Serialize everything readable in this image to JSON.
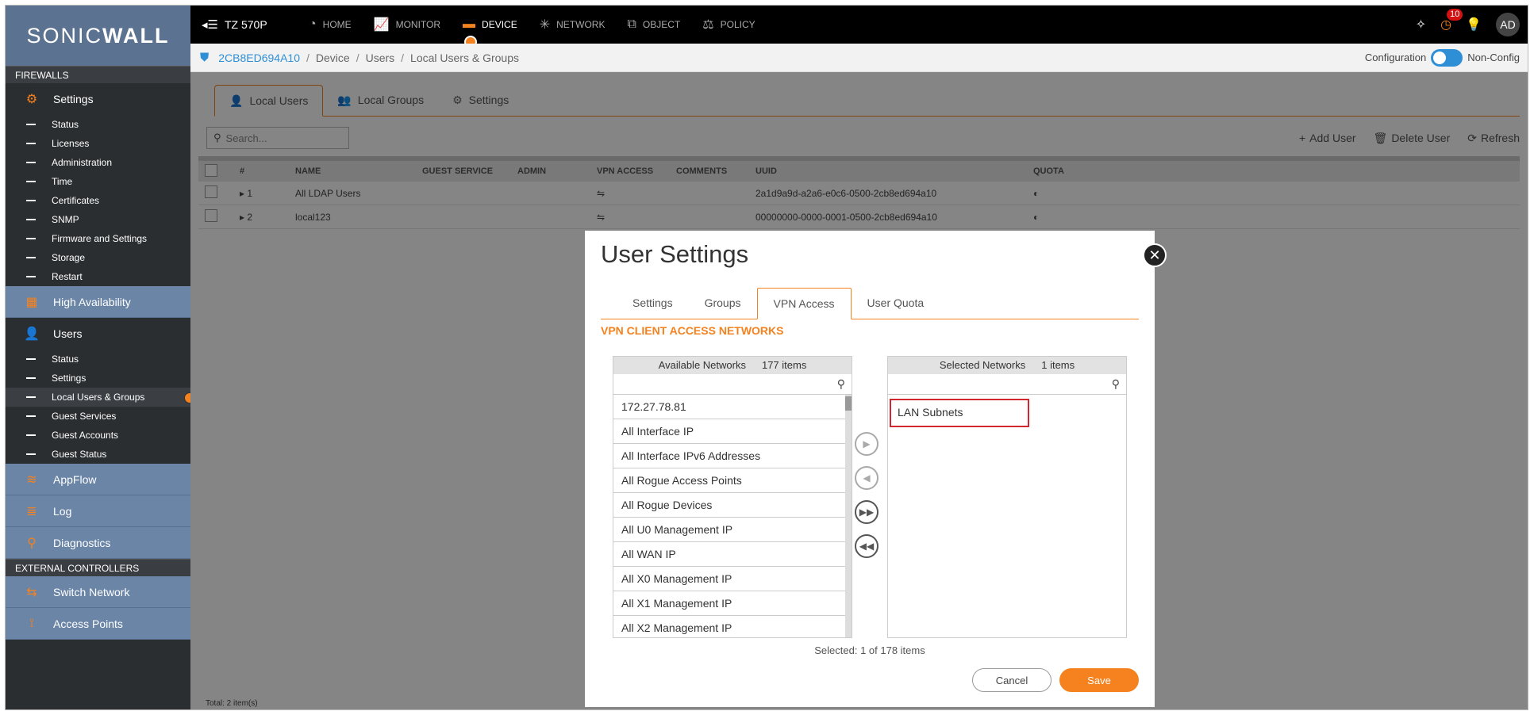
{
  "sidebar": {
    "logo_prefix": "SONIC",
    "logo_suffix": "WALL",
    "section_firewalls": "FIREWALLS",
    "settings": {
      "label": "Settings",
      "items": [
        "Status",
        "Licenses",
        "Administration",
        "Time",
        "Certificates",
        "SNMP",
        "Firmware and Settings",
        "Storage",
        "Restart"
      ]
    },
    "high_availability": "High Availability",
    "users": {
      "label": "Users",
      "items": [
        "Status",
        "Settings",
        "Local Users & Groups",
        "Guest Services",
        "Guest Accounts",
        "Guest Status"
      ]
    },
    "appflow": "AppFlow",
    "log": "Log",
    "diagnostics": "Diagnostics",
    "section_external": "EXTERNAL CONTROLLERS",
    "switch_network": "Switch Network",
    "access_points": "Access Points"
  },
  "topbar": {
    "device": "TZ 570P",
    "nav": [
      "HOME",
      "MONITOR",
      "DEVICE",
      "NETWORK",
      "OBJECT",
      "POLICY"
    ],
    "notification_count": "10",
    "avatar": "AD"
  },
  "breadcrumb": {
    "items": [
      "2CB8ED694A10",
      "Device",
      "Users",
      "Local Users & Groups"
    ],
    "configuration": "Configuration",
    "non_config": "Non-Config"
  },
  "main": {
    "tabs": [
      "Local Users",
      "Local Groups",
      "Settings"
    ],
    "search_placeholder": "Search...",
    "actions": [
      "Add User",
      "Delete User",
      "Refresh"
    ],
    "columns": [
      "#",
      "NAME",
      "GUEST SERVICE",
      "ADMIN",
      "VPN ACCESS",
      "COMMENTS",
      "UUID",
      "QUOTA"
    ],
    "rows": [
      {
        "num": "1",
        "name": "All LDAP Users",
        "uuid": "2a1d9a9d-a2a6-e0c6-0500-2cb8ed694a10"
      },
      {
        "num": "2",
        "name": "local123",
        "uuid": "00000000-0000-0001-0500-2cb8ed694a10"
      }
    ],
    "total": "Total: 2 item(s)"
  },
  "modal": {
    "title": "User Settings",
    "tabs": [
      "Settings",
      "Groups",
      "VPN Access",
      "User Quota"
    ],
    "section": "VPN CLIENT ACCESS NETWORKS",
    "available": {
      "title": "Available Networks",
      "count": "177 items",
      "items": [
        "172.27.78.81",
        "All Interface IP",
        "All Interface IPv6 Addresses",
        "All Rogue Access Points",
        "All Rogue Devices",
        "All U0 Management IP",
        "All WAN IP",
        "All X0 Management IP",
        "All X1 Management IP",
        "All X2 Management IP"
      ]
    },
    "selected": {
      "title": "Selected Networks",
      "count": "1 items",
      "items": [
        "LAN Subnets"
      ]
    },
    "selected_count": "Selected: 1 of 178 items",
    "cancel": "Cancel",
    "save": "Save"
  },
  "colors": {
    "accent": "#f5821f",
    "sidebar_blue": "#6b85a7",
    "link_blue": "#2f8fd6",
    "highlight_red": "#d0282e"
  }
}
